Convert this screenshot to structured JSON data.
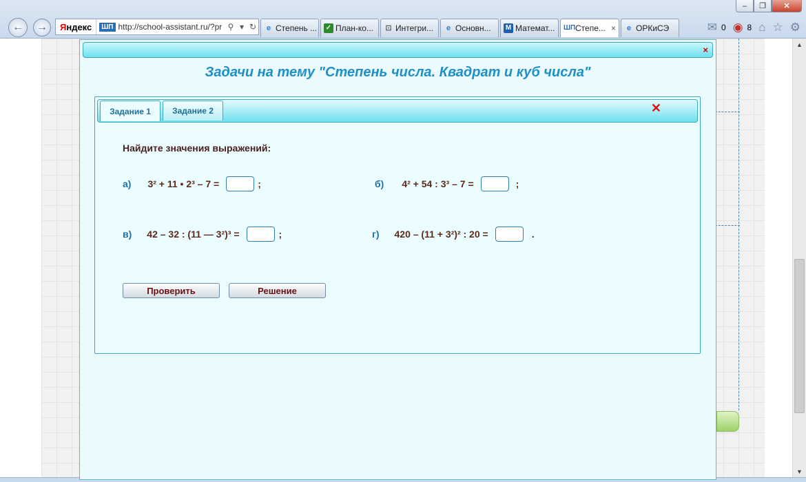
{
  "browser": {
    "address_brand": "Яндекс",
    "address_site_icon": "ШП",
    "address_url": "http://school-assistant.ru/?pr",
    "tabs": [
      {
        "label": "Степень ...",
        "icon": "ie-icon"
      },
      {
        "label": "План-ко...",
        "icon": "check-icon"
      },
      {
        "label": "Интегри...",
        "icon": "presentation-icon"
      },
      {
        "label": "Основн...",
        "icon": "ie-icon"
      },
      {
        "label": "Математ...",
        "icon": "m-icon"
      },
      {
        "label": "Степе...",
        "icon": "sp-icon",
        "active": true
      },
      {
        "label": "ОРКиСЭ",
        "icon": "ie-icon"
      }
    ],
    "mail_count": "0",
    "notify_count": "8"
  },
  "dialog": {
    "title": "Задачи на тему \"Степень числа. Квадрат и куб числа\"",
    "close_glyph": "×"
  },
  "panel": {
    "tabs": [
      "Задание 1",
      "Задание 2"
    ],
    "active_tab": "Задание 1",
    "close_glyph": "✕",
    "task_title": "Найдите значения выражений:",
    "expressions": {
      "a": {
        "label": "а)",
        "text": "3² + 11 • 2³ – 7 =",
        "after": ";"
      },
      "b": {
        "label": "б)",
        "text": "4² + 54 : 3³ – 7 =",
        "after": ";"
      },
      "v": {
        "label": "в)",
        "text": "42 – 32 : (11 — 3²)³ =",
        "after": ";"
      },
      "g": {
        "label": "г)",
        "text": "420 – (11 + 3²)² : 20 =",
        "after": "."
      }
    },
    "check_label": "Проверить",
    "solution_label": "Решение"
  }
}
